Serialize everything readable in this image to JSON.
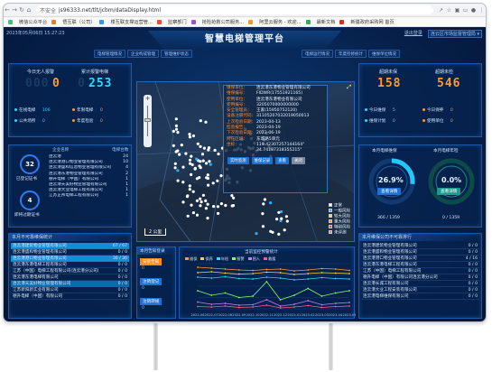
{
  "browser": {
    "back_icon": "arrow-left-icon",
    "security": "不安全",
    "url": "js96333.net/tlt/jcbm/dataDisplay.html",
    "bookmarks": [
      "微信公众平台",
      "悟互联（公司）",
      "楼互联支撑运营管...",
      "监察部门",
      "抢险抢救公司服务...",
      "阿里云服务 - 欢迎...",
      "最新文档",
      "新疆政府采购网 首页"
    ]
  },
  "header": {
    "datetime": "2023年05月06日 15:27:23",
    "title": "智慧电梯管理平台",
    "user": "退出登录",
    "org": "连云区市场监督管理局"
  },
  "nav_left": [
    "电梯管理情况",
    "企业构成管理",
    "管理维护状态"
  ],
  "nav_right": [
    "电梯运行情况",
    "年度检修统计",
    "维保单位情况"
  ],
  "left_top": {
    "c1_label": "今日无人报警",
    "c1_value": "000",
    "c1_value_bright": "0",
    "c2_label": "累计报警电梯",
    "c2_value": "253",
    "s1_label": "在线电梯",
    "s1_value": "106",
    "s2_label": "年限电梯",
    "s2_value": "0",
    "s3_label": "公共场所",
    "s3_value": "0",
    "s4_label": "年度检验",
    "s4_value": "0"
  },
  "left_mid": {
    "title": "企业名称",
    "title_right": "电梯台数",
    "ring1_value": "32",
    "ring1_label": "已登记证书",
    "ring2_value": "4",
    "ring2_label": "即将过期证书",
    "items": [
      [
        "连云港",
        "24"
      ],
      [
        "连云港港口物业管理有限公司",
        "10"
      ],
      [
        "连云港盛和信息物业管理有限公司",
        "4"
      ],
      [
        "连云港东港物业管理有限公司",
        "2"
      ],
      [
        "德升电梯（中国）有限公司",
        "1"
      ],
      [
        "连云港天美好物业管理有限公司",
        "1"
      ],
      [
        "连云港大业电梯工程有限公司",
        "1"
      ],
      [
        "江苏正邦电梯工程有限公司",
        "1"
      ]
    ]
  },
  "left_bottom": {
    "title": "本月不可靠维保统计",
    "items": [
      [
        "连云港建筑物业管理有限公司",
        "67 / 67"
      ],
      [
        "连云港盛和物业管理有限公司",
        "0 / 0"
      ],
      [
        "连云港港口物业管理有限公司",
        "36 / 36"
      ],
      [
        "连云港东港电梯工程有限公司",
        "0 / 0"
      ],
      [
        "江苏（中国）电梯工程有限公司(连云港分公司)",
        "0 / 0"
      ],
      [
        "连云港东港电梯有限公司",
        "0 / 0"
      ],
      [
        "连云港天美好物业管理有限公司",
        "0 / 0"
      ],
      [
        "江苏新阳新实业有限公司",
        "0 / 0"
      ],
      [
        "德升电梯（中国）有限公司",
        "0 / 0"
      ]
    ]
  },
  "map": {
    "popup": [
      [
        "维保单位：",
        "连云港东港物业管理有限公司"
      ],
      [
        "维保编号：",
        "FIDWR(17551921165)"
      ],
      [
        "使用单位：",
        "连云港东港物业有限公司"
      ],
      [
        "使用编号：",
        "3205070000000000"
      ],
      [
        "安全管理员：",
        "王家(15950752120)"
      ],
      [
        "设备注册代码：",
        "31105207032019050013"
      ],
      [
        "上次检验日期：",
        "2023-04-13"
      ],
      [
        "检验报告：",
        "2023-04-19"
      ],
      [
        "下次检验日期：",
        "2023-06-19"
      ],
      [
        "所在区域：",
        "东城路5单元"
      ],
      [
        "坐标：",
        "119.42307257144164°"
      ],
      [
        "",
        "34.74187318355215°"
      ]
    ],
    "btn1": "实时监测",
    "btn2": "维保记录",
    "btn3": "查看",
    "btn4": "关闭",
    "scale": "2 公里",
    "legend": [
      "正常",
      "一般风险",
      "较大风险",
      "重大风险",
      "特别风险",
      "未评测"
    ],
    "legend_colors": [
      "#ffffff",
      "#2eaaff",
      "#ffd43b",
      "#ff8c1a",
      "#ff3b3b",
      "#9d9d9d"
    ]
  },
  "right_top": {
    "c1_label": "超期未保",
    "c1_value": "158",
    "c2_label": "超期未检",
    "c2_value": "546",
    "s1_label": "今日维保",
    "s1_value": "5",
    "s2_label": "今日保养",
    "s2_value": "0",
    "s3_label": "维保计划",
    "s3_value": "0",
    "s4_label": "使用单位",
    "s4_value": "0"
  },
  "right_mid": {
    "g1_title": "本月电梯维保",
    "g1_value": "26.9%",
    "g1_btn": "查看详情",
    "g1_foot": "366 / 1359",
    "g2_title": "本月电梯年检",
    "g2_value": "0.0%",
    "g2_btn": "查看详情",
    "g2_foot": "0 / 1359"
  },
  "right_bottom": {
    "title": "本月维保公司不可靠排行",
    "items": [
      [
        "连云港建筑物业管理有限公司",
        "0 / 0"
      ],
      [
        "连云港盛和物业管理有限公司",
        "0 / 0"
      ],
      [
        "连云港港口物业管理有限公司",
        "4 / 16"
      ],
      [
        "连云港东港电梯工程有限公司",
        "0 / 0"
      ],
      [
        "江苏（中国）电梯工程有限公司",
        "0 / 0"
      ],
      [
        "德升电梯（中国）有限公司连云港分公司",
        "0 / 0"
      ],
      [
        "连云港长城工程有限公司",
        "0 / 0"
      ],
      [
        "连云港大业工程安装有限公司",
        "0 / 0"
      ],
      [
        "连云港电梯维保有限公司",
        "0 / 0"
      ]
    ]
  },
  "center_bottom": {
    "warn_title": "本月告知登录",
    "b1": "安装告知",
    "b1_value": "0",
    "b2": "注销登记",
    "b2_value": "0",
    "b3": "注销转规",
    "b3_value": "0"
  },
  "chart_data": {
    "type": "line",
    "title": "当前监控预警统计",
    "x": [
      "2022-06",
      "2022-07",
      "2022-08",
      "2022-09",
      "2022-10",
      "2022-11",
      "2022-12",
      "2023-01",
      "2023-02",
      "2023-03",
      "2023-04",
      "2023-05"
    ],
    "series": [
      {
        "name": "维保",
        "color": "#ff9a2e",
        "values": [
          92,
          90,
          88,
          86,
          85,
          87,
          88,
          84,
          86,
          89,
          88,
          85
        ]
      },
      {
        "name": "保养",
        "color": "#ffd43b",
        "values": [
          80,
          82,
          79,
          77,
          78,
          81,
          80,
          76,
          78,
          80,
          79,
          78
        ]
      },
      {
        "name": "年检",
        "color": "#33d7ff",
        "values": [
          70,
          68,
          71,
          67,
          66,
          70,
          68,
          64,
          66,
          69,
          67,
          66
        ]
      },
      {
        "name": "报警",
        "color": "#7cff6b",
        "values": [
          40,
          30,
          35,
          25,
          28,
          60,
          20,
          30,
          45,
          28,
          35,
          40
        ]
      },
      {
        "name": "困人",
        "color": "#c77dff",
        "values": [
          15,
          10,
          12,
          8,
          9,
          20,
          6,
          10,
          18,
          9,
          12,
          14
        ]
      },
      {
        "name": "救援",
        "color": "#ff5c8a",
        "values": [
          5,
          4,
          6,
          3,
          4,
          8,
          2,
          4,
          7,
          3,
          5,
          6
        ]
      }
    ],
    "ylim": [
      0,
      100
    ]
  }
}
